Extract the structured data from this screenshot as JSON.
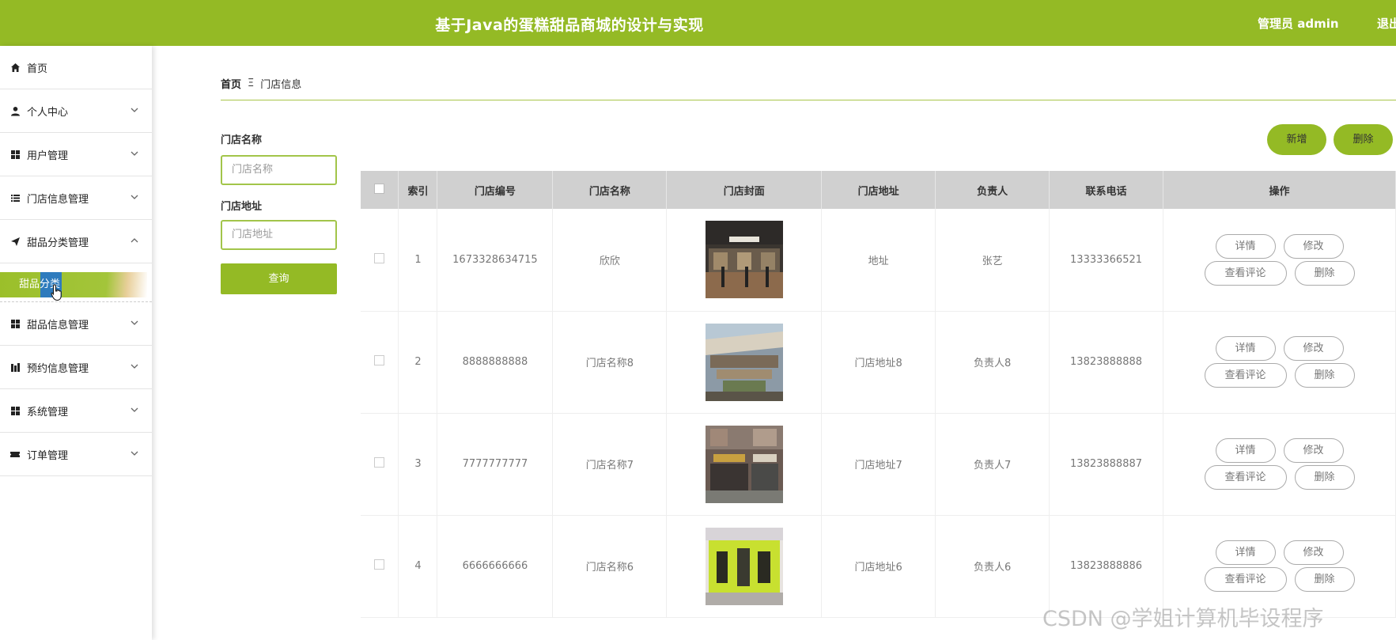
{
  "header": {
    "title": "基于Java的蛋糕甜品商城的设计与实现",
    "user": "管理员 admin",
    "logout": "退出"
  },
  "sidebar": {
    "items": [
      {
        "label": "首页",
        "icon": "home-icon"
      },
      {
        "label": "个人中心",
        "icon": "user-icon"
      },
      {
        "label": "用户管理",
        "icon": "grid-icon"
      },
      {
        "label": "门店信息管理",
        "icon": "list-icon"
      },
      {
        "label": "甜品分类管理",
        "icon": "send-icon"
      },
      {
        "label": "甜品信息管理",
        "icon": "grid-icon"
      },
      {
        "label": "预约信息管理",
        "icon": "chart-icon"
      },
      {
        "label": "系统管理",
        "icon": "grid-icon"
      },
      {
        "label": "订单管理",
        "icon": "ticket-icon"
      }
    ],
    "sub_item": "甜品分类"
  },
  "breadcrumb": {
    "home": "首页",
    "sep": "Ξ",
    "current": "门店信息"
  },
  "search": {
    "name_label": "门店名称",
    "name_placeholder": "门店名称",
    "address_label": "门店地址",
    "address_placeholder": "门店地址",
    "query_label": "查询"
  },
  "toolbar": {
    "add_label": "新增",
    "delete_label": "删除"
  },
  "table": {
    "headers": [
      "索引",
      "门店编号",
      "门店名称",
      "门店封面",
      "门店地址",
      "负责人",
      "联系电话",
      "操作"
    ],
    "rows": [
      {
        "index": "1",
        "code": "1673328634715",
        "name": "欣欣",
        "address": "地址",
        "manager": "张艺",
        "phone": "13333366521"
      },
      {
        "index": "2",
        "code": "8888888888",
        "name": "门店名称8",
        "address": "门店地址8",
        "manager": "负责人8",
        "phone": "13823888888"
      },
      {
        "index": "3",
        "code": "7777777777",
        "name": "门店名称7",
        "address": "门店地址7",
        "manager": "负责人7",
        "phone": "13823888887"
      },
      {
        "index": "4",
        "code": "6666666666",
        "name": "门店名称6",
        "address": "门店地址6",
        "manager": "负责人6",
        "phone": "13823888886"
      }
    ],
    "actions": {
      "detail": "详情",
      "edit": "修改",
      "comments": "查看评论",
      "delete": "删除"
    }
  },
  "watermark": "CSDN @学姐计算机毕设程序",
  "colors": {
    "accent": "#94ba25",
    "header_bg": "#94ba25",
    "table_header_bg": "#d0d0d0"
  }
}
